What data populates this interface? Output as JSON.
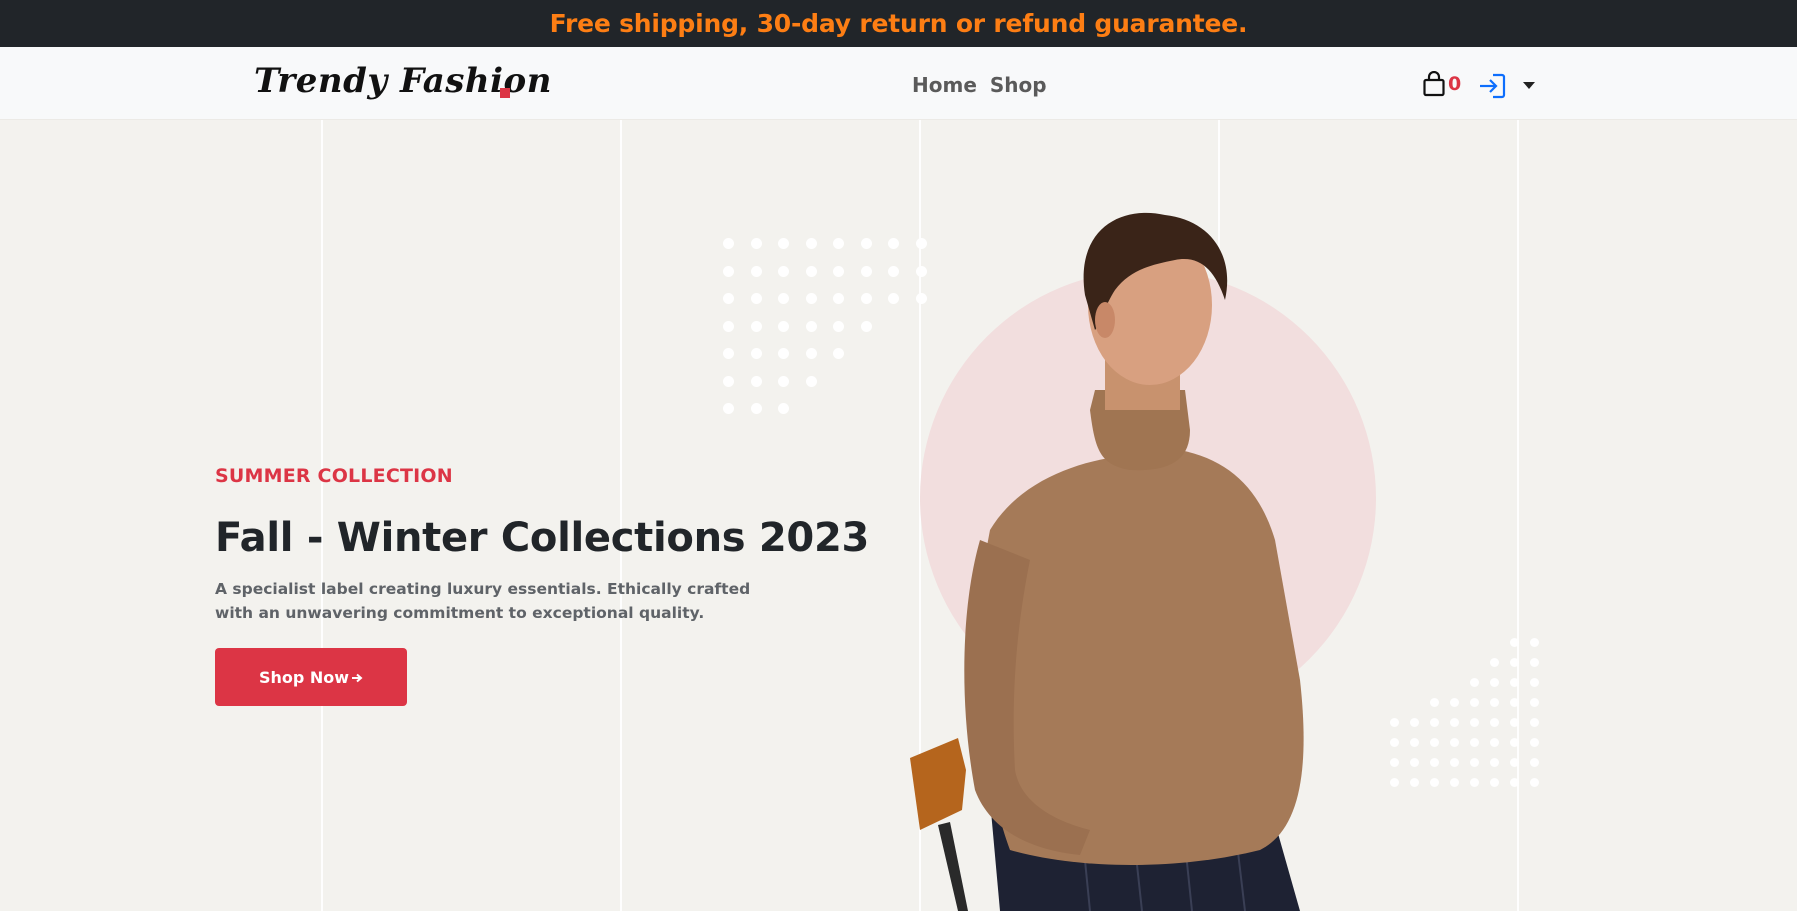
{
  "announcement": {
    "text": "Free shipping, 30-day return or refund guarantee."
  },
  "navbar": {
    "brand": "Trendy Fashion",
    "links": [
      {
        "label": "Home"
      },
      {
        "label": "Shop"
      }
    ],
    "cart": {
      "icon": "shopping-bag-icon",
      "count": "0"
    },
    "login": {
      "icon": "login-icon"
    },
    "dropdown": {
      "icon": "caret-down-icon"
    }
  },
  "hero": {
    "eyebrow": "SUMMER COLLECTION",
    "title": "Fall - Winter Collections 2023",
    "description": "A specialist label creating luxury essentials. Ethically crafted with an unwavering commitment to exceptional quality.",
    "button": {
      "label": "Shop Now",
      "icon": "arrow-right-icon"
    },
    "image": "model-in-turtleneck"
  },
  "colors": {
    "accent": "#dc3545",
    "announcement_text": "#fd7e14",
    "announcement_bg": "#212529",
    "hero_bg": "#f3f2ee",
    "circle": "#f2dede"
  }
}
